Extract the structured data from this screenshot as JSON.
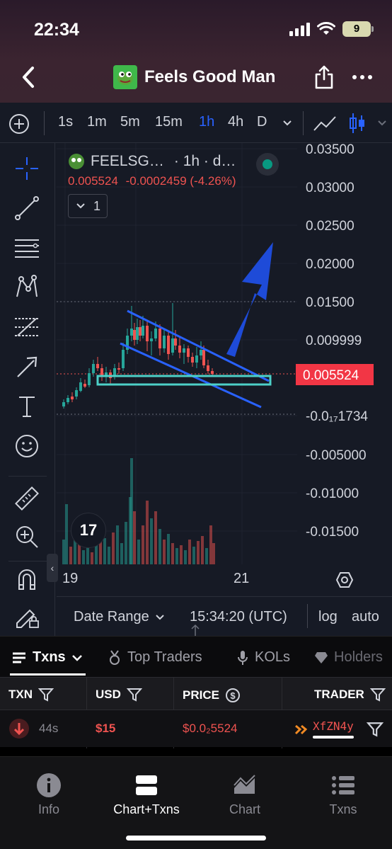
{
  "status_bar": {
    "time": "22:34",
    "battery": "9"
  },
  "header": {
    "title": "Feels Good Man"
  },
  "toolbar": {
    "timeframes": [
      "1s",
      "1m",
      "5m",
      "15m",
      "1h",
      "4h",
      "D"
    ],
    "active_timeframe": "1h"
  },
  "legend": {
    "symbol": "FEELSG…",
    "interval": "· 1h · d…",
    "price": "0.005524",
    "change": "-0.0002459 (-4.26%)",
    "collapse_count": "1"
  },
  "price_axis": {
    "labels": [
      "0.03500",
      "0.03000",
      "0.02500",
      "0.02000",
      "0.01500",
      "0.009999",
      "-0.0₁₇1734",
      "-0.005000",
      "-0.01000",
      "-0.01500"
    ],
    "current_price": "0.005524"
  },
  "time_axis": {
    "labels": [
      "19",
      "21"
    ]
  },
  "chart_footer": {
    "date_range": "Date Range",
    "time": "15:34:20 (UTC)",
    "log": "log",
    "auto": "auto"
  },
  "colors": {
    "up": "#26a69a",
    "down": "#ef5350",
    "accent": "#2962ff",
    "price_tag": "#f23645"
  },
  "tabs": [
    {
      "label": "Txns",
      "icon": "list-icon"
    },
    {
      "label": "Top Traders",
      "icon": "medal-icon"
    },
    {
      "label": "KOLs",
      "icon": "mic-icon"
    },
    {
      "label": "Holders",
      "icon": "diamond-icon"
    }
  ],
  "table": {
    "headers": [
      "TXN",
      "USD",
      "PRICE",
      "TRADER"
    ],
    "rows": [
      {
        "age": "44s",
        "usd": "$15",
        "price": "$0.0₂5524",
        "trader": "XfZN4y"
      }
    ]
  },
  "bottom_nav": [
    {
      "label": "Info",
      "icon": "info-icon"
    },
    {
      "label": "Chart+Txns",
      "icon": "split-view-icon"
    },
    {
      "label": "Chart",
      "icon": "chart-icon"
    },
    {
      "label": "Txns",
      "icon": "list-icon"
    }
  ]
}
